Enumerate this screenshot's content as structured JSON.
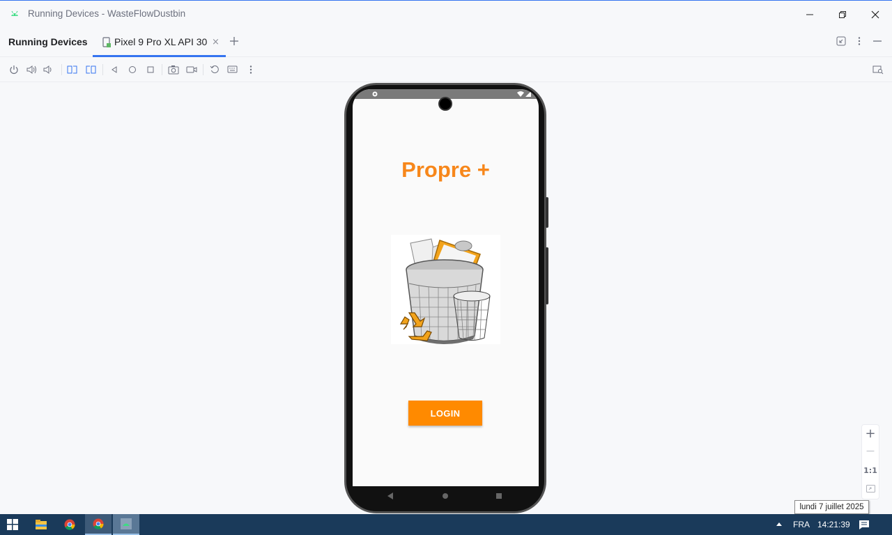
{
  "window": {
    "title": "Running Devices - WasteFlowDustbin"
  },
  "tabbar": {
    "section_title": "Running Devices",
    "tab_label": "Pixel 9 Pro XL API 30",
    "tab_close": "×",
    "add_tab": "+"
  },
  "toolbar": {
    "icons": [
      "power-icon",
      "volume-up-icon",
      "volume-down-icon",
      "rotate-left-icon",
      "rotate-right-icon",
      "back-icon",
      "home-icon",
      "overview-icon",
      "screenshot-icon",
      "screen-record-icon",
      "reset-icon",
      "keyboard-icon",
      "more-icon",
      "device-explorer-icon"
    ]
  },
  "app": {
    "title": "Propre +",
    "login_label": "LOGIN"
  },
  "zoom": {
    "zoom_in": "+",
    "zoom_out": "—",
    "actual_size": "1:1"
  },
  "tooltip": "lundi 7 juillet 2025",
  "taskbar": {
    "language": "FRA",
    "time": "14:21:39"
  },
  "colors": {
    "accent": "#3574f0",
    "brand_orange": "#f7871b",
    "button_orange": "#ff8a00",
    "taskbar": "#1a3a5a"
  }
}
